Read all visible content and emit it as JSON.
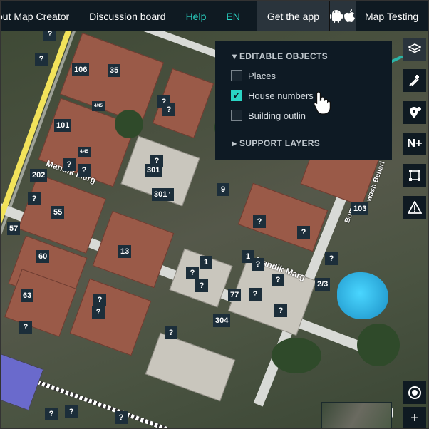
{
  "topbar": {
    "app_name": "out Map Creator",
    "discussion": "Discussion board",
    "help": "Help",
    "lang": "EN",
    "get_app": "Get the app",
    "project": "Map Testing"
  },
  "panel": {
    "editable_header": "▾ EDITABLE OBJECTS",
    "items": [
      {
        "label": "Places",
        "checked": false
      },
      {
        "label": "House numbers",
        "checked": true
      },
      {
        "label": "Building outlin",
        "checked": false
      }
    ],
    "support_header": "▸ SUPPORT LAYERS"
  },
  "map": {
    "street_names": [
      "Mandik Marg",
      "Mandik Marg",
      "Boma",
      "wash Behari"
    ],
    "house_labels": [
      "?",
      "?",
      "106",
      "35",
      "?",
      "?",
      "4/45",
      "101",
      "?",
      "4/45",
      "?",
      "?",
      "301",
      "202",
      "?",
      "?",
      "9",
      "?",
      "55",
      "301",
      "103",
      "?",
      "57",
      "?",
      "13",
      "60",
      "?",
      "1",
      "?",
      "?",
      "1",
      "?",
      "2/3",
      "63",
      "?",
      "77",
      "?",
      "?",
      "304",
      "?",
      "?",
      "?",
      "?",
      "?",
      "?"
    ]
  },
  "icons": {
    "layers": "layers-icon",
    "add_house_number": "add-house-number-icon",
    "add_place": "add-place-icon",
    "add_street": "add-street-icon",
    "draw_outline": "draw-outline-icon",
    "warning": "warning-icon",
    "locate": "locate-icon",
    "zoom_in": "zoom-in-icon"
  },
  "toolbar": {
    "street_tool_label": "N+",
    "zoom_label": "+"
  },
  "colors": {
    "accent": "#2ad4c4",
    "topbar": "#0f1a22",
    "panel": "#0e1a24"
  }
}
